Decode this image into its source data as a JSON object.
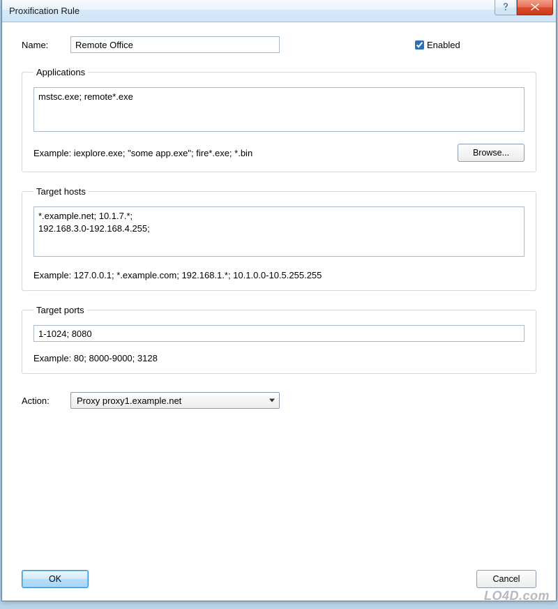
{
  "window": {
    "title": "Proxification Rule"
  },
  "name": {
    "label": "Name:",
    "value": "Remote Office"
  },
  "enabled": {
    "label": "Enabled",
    "checked": true
  },
  "applications": {
    "legend": "Applications",
    "value": "mstsc.exe; remote*.exe",
    "example": "Example: iexplore.exe; \"some app.exe\"; fire*.exe; *.bin",
    "browse": "Browse..."
  },
  "targetHosts": {
    "legend": "Target hosts",
    "value": "*.example.net; 10.1.7.*;\n192.168.3.0-192.168.4.255;",
    "example": "Example: 127.0.0.1; *.example.com; 192.168.1.*; 10.1.0.0-10.5.255.255"
  },
  "targetPorts": {
    "legend": "Target ports",
    "value": "1-1024; 8080",
    "example": "Example: 80; 8000-9000; 3128"
  },
  "action": {
    "label": "Action:",
    "value": "Proxy proxy1.example.net"
  },
  "buttons": {
    "ok": "OK",
    "cancel": "Cancel"
  },
  "watermark": "LO4D.com"
}
